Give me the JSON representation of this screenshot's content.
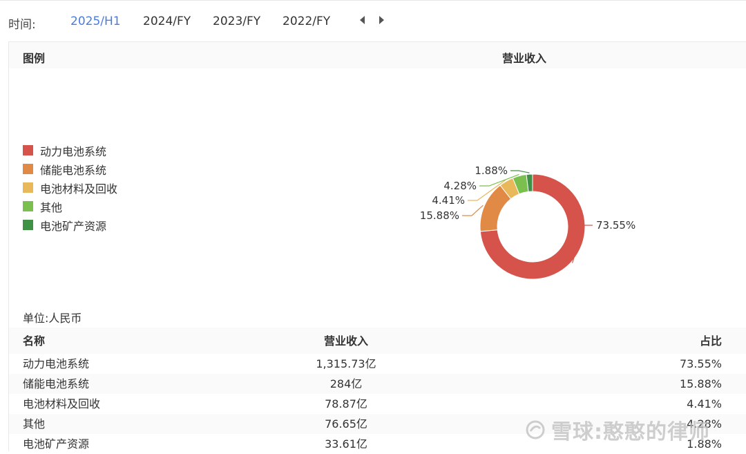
{
  "topbar": {
    "time_label": "时间:",
    "periods": [
      "2025/H1",
      "2024/FY",
      "2023/FY",
      "2022/FY"
    ],
    "active_period": "2025/H1"
  },
  "panel": {
    "legend_title": "图例",
    "chart_title": "营业收入",
    "unit": "单位:人民币"
  },
  "legend": [
    {
      "label": "动力电池系统",
      "color": "#d5534a"
    },
    {
      "label": "储能电池系统",
      "color": "#e08a45"
    },
    {
      "label": "电池材料及回收",
      "color": "#e9b85a"
    },
    {
      "label": "其他",
      "color": "#7bbf4f"
    },
    {
      "label": "电池矿产资源",
      "color": "#3f9146"
    }
  ],
  "chart_data": {
    "type": "pie",
    "title": "营业收入",
    "categories": [
      "动力电池系统",
      "储能电池系统",
      "电池材料及回收",
      "其他",
      "电池矿产资源"
    ],
    "values": [
      73.55,
      15.88,
      4.41,
      4.28,
      1.88
    ],
    "labels": [
      "73.55%",
      "15.88%",
      "4.41%",
      "4.28%",
      "1.88%"
    ],
    "colors": [
      "#d5534a",
      "#e08a45",
      "#e9b85a",
      "#7bbf4f",
      "#3f9146"
    ],
    "donut": true
  },
  "table": {
    "headers": [
      "名称",
      "营业收入",
      "占比"
    ],
    "rows": [
      [
        "动力电池系统",
        "1,315.73亿",
        "73.55%"
      ],
      [
        "储能电池系统",
        "284亿",
        "15.88%"
      ],
      [
        "电池材料及回收",
        "78.87亿",
        "4.41%"
      ],
      [
        "其他",
        "76.65亿",
        "4.28%"
      ],
      [
        "电池矿产资源",
        "33.61亿",
        "1.88%"
      ]
    ]
  },
  "watermark": {
    "text": "雪球:憨憨的律师"
  }
}
